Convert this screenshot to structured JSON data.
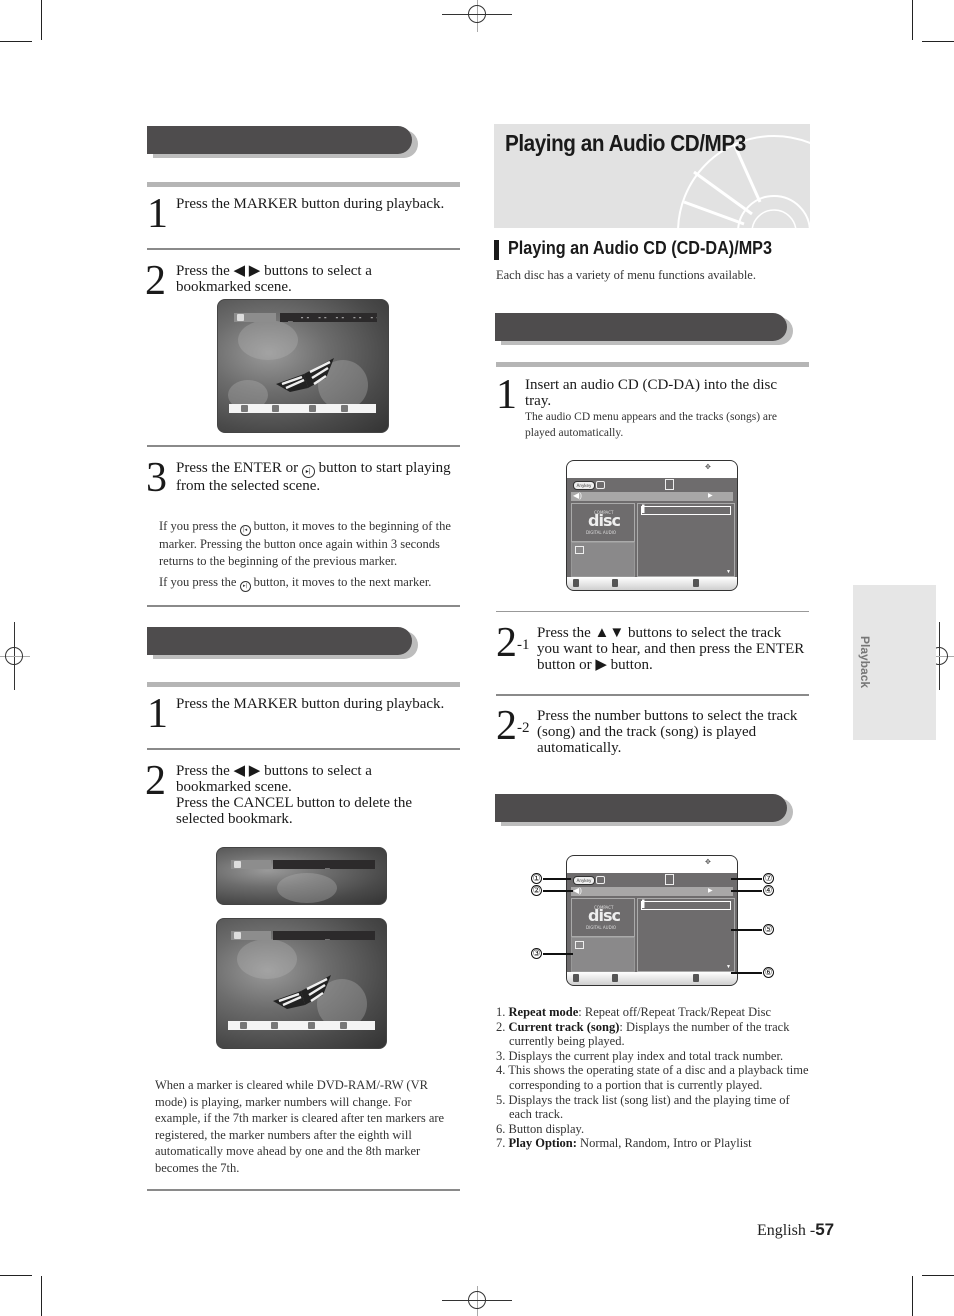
{
  "left": {
    "section1": {
      "step1": {
        "num": "1",
        "text": "Press the MARKER button during playback."
      },
      "step2": {
        "num": "2",
        "text": "Press the ◀ ▶ buttons to select a bookmarked scene."
      },
      "step3": {
        "num": "3",
        "text_a": "Press the ENTER or",
        "text_b": "button to start playing from the selected scene."
      },
      "notes": [
        {
          "a": "If you press the",
          "b": "button, it moves to the beginning of the marker. Pressing the button once again within 3 seconds returns to the beginning of the previous marker."
        },
        {
          "a": "If you press the",
          "b": "button, it moves to the next marker."
        }
      ]
    },
    "section2": {
      "step1": {
        "num": "1",
        "text": "Press the MARKER button during playback."
      },
      "step2": {
        "num": "2",
        "text_a": "Press the ◀ ▶ buttons to select a bookmarked scene.",
        "text_b": "Press the CANCEL button to delete the selected bookmark."
      },
      "note": "When a marker is cleared while DVD-RAM/-RW (VR mode) is playing, marker numbers will change. For example, if the 7th marker is cleared after ten markers are registered, the marker numbers after the eighth will automatically move ahead by one and the 8th marker becomes the 7th."
    },
    "osd": {
      "markers": "_ -- -- -- -- -- -- -- --",
      "marker_single": "_"
    }
  },
  "right": {
    "hero_title": "Playing an Audio CD/MP3",
    "subhead": "Playing an Audio CD (CD-DA)/MP3",
    "intro": "Each disc has a variety of menu functions available.",
    "step1": {
      "num": "1",
      "text": "Insert an audio CD (CD-DA) into the disc tray.",
      "sub": "The audio CD menu appears and the tracks (songs) are played automatically."
    },
    "step2_1": {
      "num": "2",
      "sup": "-1",
      "text": "Press the ▲▼ buttons to select the track you want to hear, and then press the ENTER button or ▶ button."
    },
    "step2_2": {
      "num": "2",
      "sup": "-2",
      "text": "Press the number buttons to select the track (song) and the track (song) is played automatically."
    },
    "cdmenu": {
      "anykey": "Anykey",
      "disc_logo_top": "COMPACT",
      "disc_logo": "disc",
      "disc_logo_bottom": "DIGITAL AUDIO"
    },
    "callouts": [
      "①",
      "②",
      "③",
      "④",
      "⑤",
      "⑥",
      "⑦"
    ],
    "legend": [
      {
        "n": "1.",
        "bold": "Repeat mode",
        "rest": ": Repeat off/Repeat Track/Repeat Disc"
      },
      {
        "n": "2.",
        "bold": "Current track (song)",
        "rest": ": Displays the number of the track currently being played."
      },
      {
        "n": "3.",
        "bold": "",
        "rest": "Displays the current play index and total track number."
      },
      {
        "n": "4.",
        "bold": "",
        "rest": "This shows the operating state of a disc and a playback time corresponding to a portion that is currently played."
      },
      {
        "n": "5.",
        "bold": "",
        "rest": "Displays the track list (song list) and the playing time of each track."
      },
      {
        "n": "6.",
        "bold": "",
        "rest": "Button display."
      },
      {
        "n": "7.",
        "bold": "Play Option:",
        "rest": " Normal, Random, Intro or Playlist"
      }
    ]
  },
  "side_tab": "Playback",
  "footer": {
    "lang": "English -",
    "page": "57"
  }
}
